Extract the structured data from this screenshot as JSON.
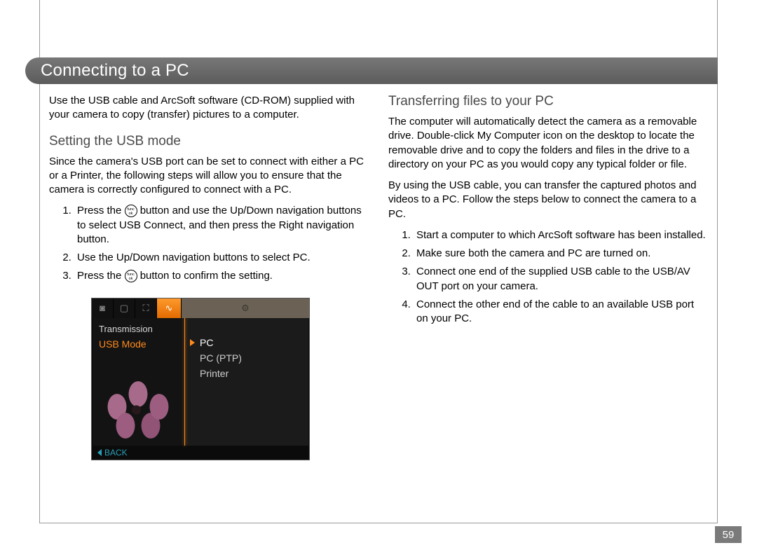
{
  "page_number": "59",
  "title": "Connecting to a PC",
  "func_button": {
    "line1": "func",
    "line2": "ok"
  },
  "left": {
    "intro": "Use the USB cable and ArcSoft software (CD-ROM) supplied with your camera to copy (transfer) pictures to a computer.",
    "h_usb": "Setting the USB mode",
    "usb_intro": "Since the camera's USB port can be set to connect with either a PC or a Printer, the following steps will allow you to ensure that the camera is correctly configured to connect with a PC.",
    "steps": {
      "s1a": "Press the ",
      "s1b": " button and use the Up/Down navigation buttons to select USB Connect, and then press the Right navigation button.",
      "s2": "Use the Up/Down navigation buttons to select PC.",
      "s3a": "Press the ",
      "s3b": " button to confirm the setting."
    }
  },
  "right": {
    "h_transfer": "Transferring files to your PC",
    "p1": "The computer will automatically detect the camera as a removable drive. Double-click My Computer icon on the desktop to locate the removable drive and to copy the folders and files in the drive to a directory on your PC as you would copy any typical folder or file.",
    "p2": "By using the USB cable, you can transfer the captured photos and videos to a PC. Follow the steps below to connect the camera to a PC.",
    "steps": {
      "s1": "Start a computer to which ArcSoft software has been installed.",
      "s2": "Make sure both the camera and PC are turned on.",
      "s3": "Connect one end of the supplied USB cable to the USB/AV OUT port on your camera.",
      "s4": "Connect the other end of the cable to an available USB port on your PC."
    }
  },
  "cam": {
    "tabs": [
      "◙",
      "▢",
      "⛶",
      "∿",
      "⚙"
    ],
    "section": "Transmission",
    "left_selected": "USB Mode",
    "options": [
      "PC",
      "PC (PTP)",
      "Printer"
    ],
    "back": "BACK"
  }
}
